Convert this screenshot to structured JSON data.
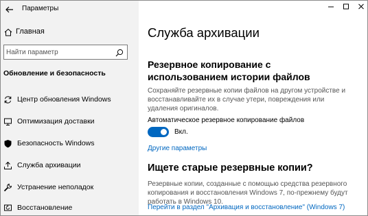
{
  "window": {
    "title": "Параметры"
  },
  "sidebar": {
    "home_label": "Главная",
    "search_placeholder": "Найти параметр",
    "section_heading": "Обновление и безопасность",
    "items": [
      {
        "label": "Центр обновления Windows",
        "icon": "sync-icon"
      },
      {
        "label": "Оптимизация доставки",
        "icon": "delivery-optimization-icon"
      },
      {
        "label": "Безопасность Windows",
        "icon": "shield-icon"
      },
      {
        "label": "Служба архивации",
        "icon": "backup-icon"
      },
      {
        "label": "Устранение неполадок",
        "icon": "wrench-icon"
      },
      {
        "label": "Восстановление",
        "icon": "recovery-icon"
      }
    ]
  },
  "main": {
    "title": "Служба архивации",
    "file_history_heading": "Резервное копирование с использованием истории файлов",
    "file_history_desc": "Сохраняйте резервные копии файлов на другом устройстве и восстанавливайте их в случае утери, повреждения или удаления оригиналов.",
    "auto_backup_label": "Автоматическое резервное копирование файлов",
    "auto_backup_state": "Вкл.",
    "auto_backup_on": true,
    "more_options_link": "Другие параметры",
    "old_backups_heading": "Ищете старые резервные копии?",
    "old_backups_desc": "Резервные копии, созданные с помощью средства резервного копирования и восстановления Windows 7, по-прежнему будут работать в Windows 10.",
    "win7_link": "Перейти в раздел \"Архивация и восстановление\" (Windows 7)"
  },
  "colors": {
    "accent": "#0067c0",
    "sidebar_bg": "#f2f2f2",
    "secondary_text": "#555555"
  }
}
